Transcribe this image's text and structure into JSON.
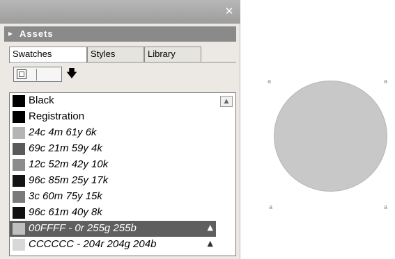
{
  "panel": {
    "close_glyph": "✕",
    "header_caret": "▸",
    "header_title": "Assets"
  },
  "tabs": [
    {
      "label": "Swatches",
      "active": true
    },
    {
      "label": "Styles",
      "active": false
    },
    {
      "label": "Library",
      "active": false
    }
  ],
  "toolbar": {
    "arrow_glyph": "🡇"
  },
  "swatches": [
    {
      "name": "Black",
      "color": "#000000",
      "italic": false,
      "selected": false
    },
    {
      "name": "Registration",
      "color": "#000000",
      "italic": false,
      "selected": false
    },
    {
      "name": "24c 4m 61y 6k",
      "color": "#b4b4b4",
      "italic": true,
      "selected": false
    },
    {
      "name": "69c 21m 59y 4k",
      "color": "#5a5a5a",
      "italic": true,
      "selected": false
    },
    {
      "name": "12c 52m 42y 10k",
      "color": "#8c8c8c",
      "italic": true,
      "selected": false
    },
    {
      "name": "96c 85m 25y 17k",
      "color": "#141414",
      "italic": true,
      "selected": false
    },
    {
      "name": "3c 60m 75y 15k",
      "color": "#7a7a7a",
      "italic": true,
      "selected": false
    },
    {
      "name": "96c 61m 40y 8k",
      "color": "#111111",
      "italic": true,
      "selected": false
    },
    {
      "name": "00FFFF - 0r 255g 255b",
      "color": "#bfbfbf",
      "italic": true,
      "selected": true,
      "icon": "▲"
    },
    {
      "name": "CCCCCC - 204r 204g 204b",
      "color": "#d8d8d8",
      "italic": true,
      "selected": false,
      "icon": "▲"
    }
  ],
  "canvas": {
    "circle_color": "#c8c8c8",
    "corner_labels": [
      "a",
      "a",
      "a",
      "a"
    ]
  }
}
